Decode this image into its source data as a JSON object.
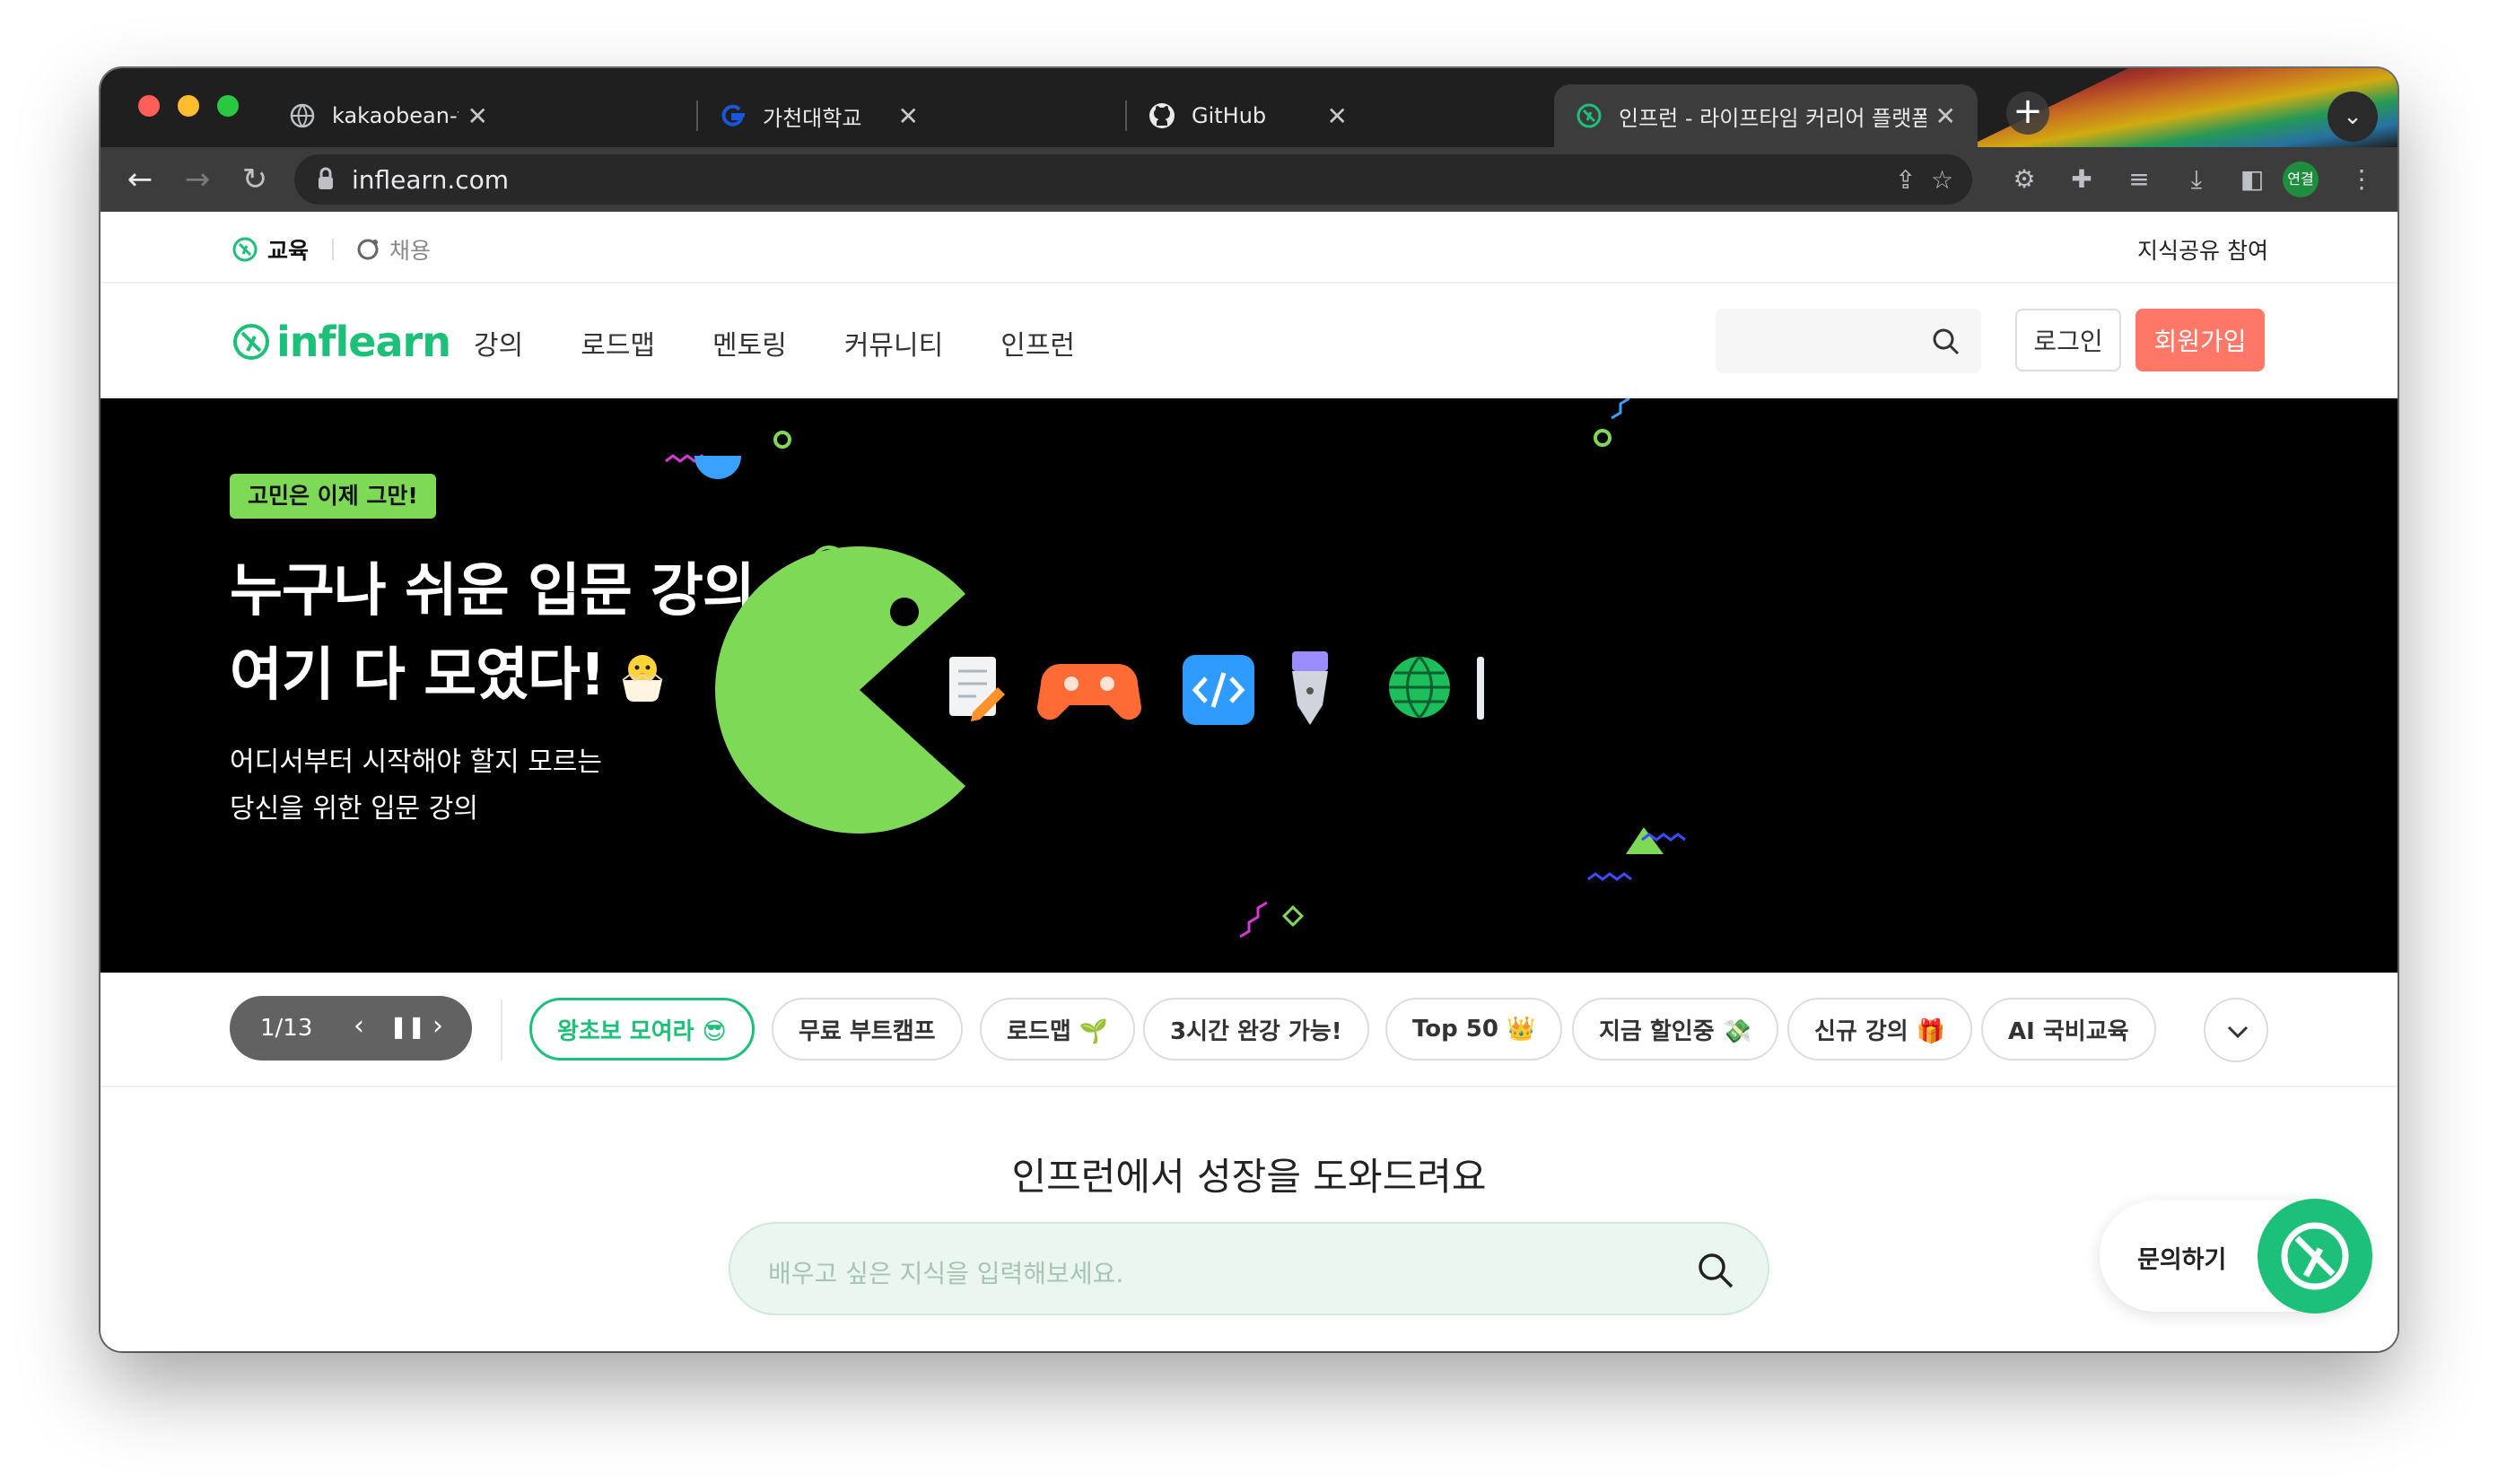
{
  "browser": {
    "tabs": [
      {
        "title": "kakaobean-front",
        "favicon": "globe-icon"
      },
      {
        "title": "가천대학교",
        "favicon": "gachon-logo-icon"
      },
      {
        "title": "GitHub",
        "favicon": "github-icon"
      },
      {
        "title": "인프런 - 라이프타임 커리어 플랫폼",
        "favicon": "inflearn-icon",
        "active": true
      }
    ],
    "url": "inflearn.com",
    "profile_label": "연결"
  },
  "topbar": {
    "edu_label": "교육",
    "hire_label": "채용",
    "share_label": "지식공유 참여"
  },
  "header": {
    "logo_text": "inflearn",
    "menu": [
      "강의",
      "로드맵",
      "멘토링",
      "커뮤니티",
      "인프런"
    ],
    "search_placeholder": "",
    "login_label": "로그인",
    "signup_label": "회원가입"
  },
  "hero": {
    "badge": "고민은 이제 그만!",
    "title_line1": "누구나 쉬운 입문 강의",
    "title_line2": "여기 다 모였다!",
    "sub_line1": "어디서부터 시작해야 할지 모르는",
    "sub_line2": "당신을 위한 입문 강의"
  },
  "carousel": {
    "counter": "1/13",
    "chips": [
      {
        "label": "왕초보 모여라 😎",
        "active": true
      },
      {
        "label": "무료 부트캠프"
      },
      {
        "label": "로드맵 🌱"
      },
      {
        "label": "3시간 완강 가능!"
      },
      {
        "label": "Top 50 👑"
      },
      {
        "label": "지금 할인중 💸"
      },
      {
        "label": "신규 강의 🎁"
      },
      {
        "label": "AI 국비교육"
      }
    ]
  },
  "main": {
    "headline": "인프런에서 성장을 도와드려요",
    "search_placeholder": "배우고 싶은 지식을 입력해보세요."
  },
  "inquiry": {
    "label": "문의하기"
  },
  "colors": {
    "brand": "#1dc078",
    "signup": "#ff7867",
    "hero_bg": "#000000",
    "pacman": "#7ed957"
  }
}
